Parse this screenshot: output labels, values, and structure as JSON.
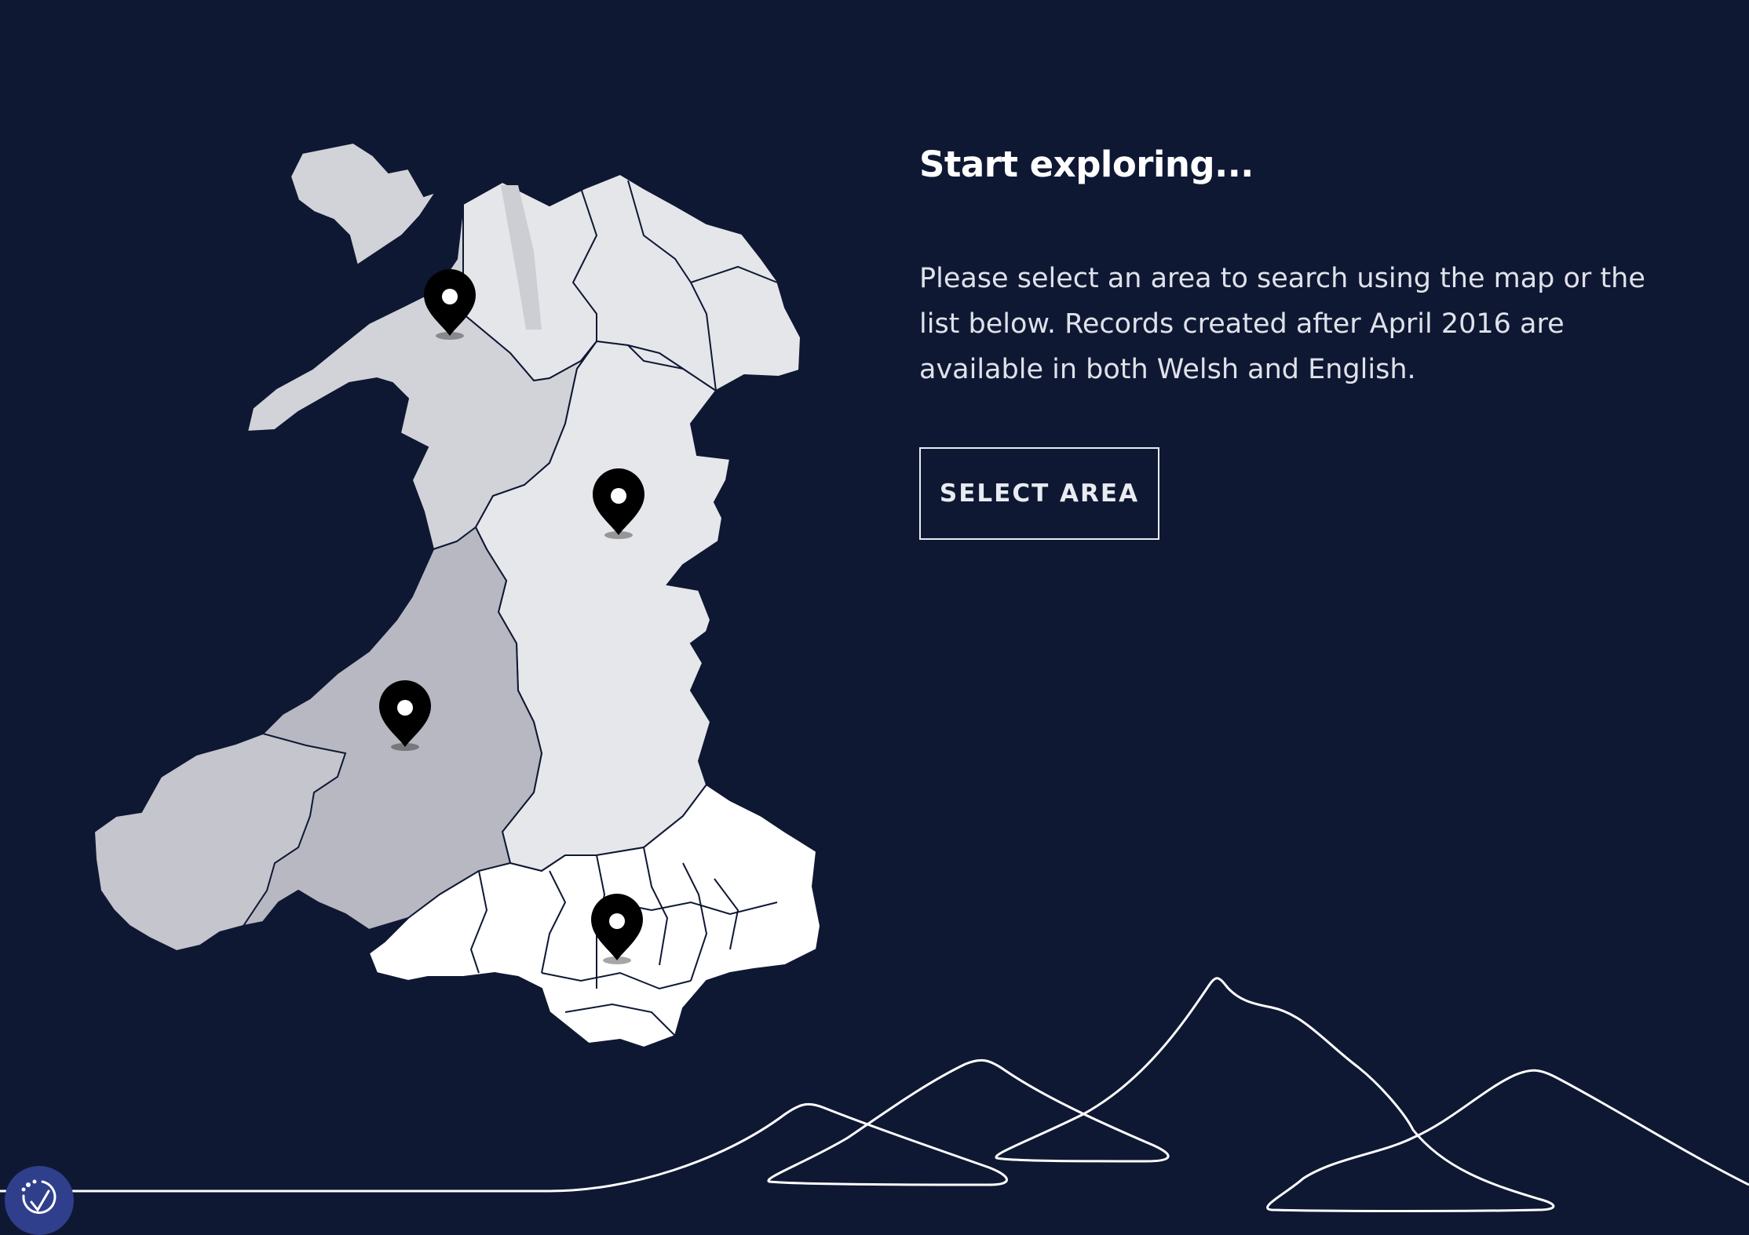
{
  "panel": {
    "heading": "Start exploring...",
    "description": "Please select an area to search using the map or the list below. Records created after April 2016 are available in both Welsh and English.",
    "button_label": "SELECT AREA"
  },
  "map": {
    "regions": [
      "north-west",
      "north-east",
      "mid",
      "south-west",
      "south-east"
    ],
    "pins": [
      "north-west-pin",
      "mid-pin",
      "south-west-pin",
      "south-east-pin"
    ]
  },
  "colors": {
    "background": "#0f1833",
    "region_north_west": "#d2d3d9",
    "region_north_east": "#e5e6ea",
    "region_mid": "#e6e7ea",
    "region_south_west": "#b7b8c2",
    "region_south_east": "#ffffff",
    "pin": "#000000",
    "button_border": "#e8ebf2",
    "accessibility_badge": "#2f3f8c"
  },
  "icons": {
    "map_pin": "map-pin-icon",
    "accessibility": "accessibility-check-icon"
  }
}
